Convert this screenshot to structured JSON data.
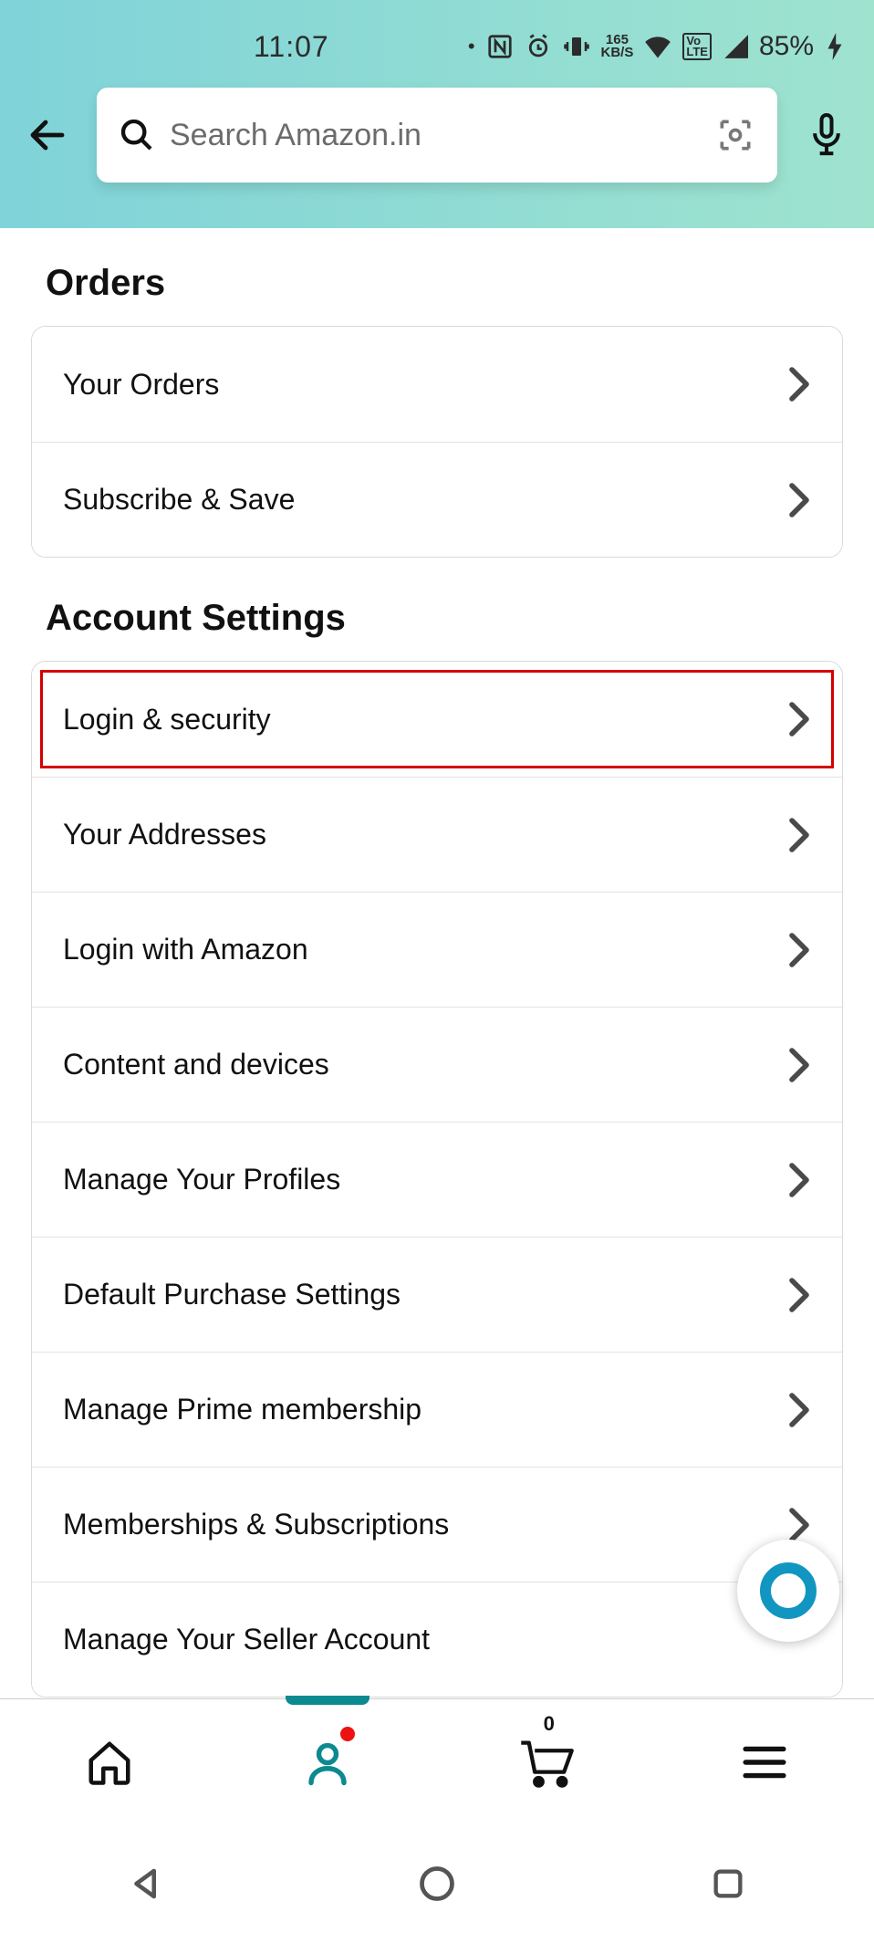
{
  "status": {
    "time": "11:07",
    "speed_value": "165",
    "speed_unit": "KB/S",
    "battery": "85%"
  },
  "search": {
    "placeholder": "Search Amazon.in"
  },
  "sections": {
    "orders": {
      "title": "Orders",
      "items": [
        {
          "label": "Your Orders"
        },
        {
          "label": "Subscribe & Save"
        }
      ]
    },
    "account": {
      "title": "Account Settings",
      "items": [
        {
          "label": "Login & security",
          "highlighted": true
        },
        {
          "label": "Your Addresses"
        },
        {
          "label": "Login with Amazon"
        },
        {
          "label": "Content and devices"
        },
        {
          "label": "Manage Your Profiles"
        },
        {
          "label": "Default Purchase Settings"
        },
        {
          "label": "Manage Prime membership"
        },
        {
          "label": "Memberships & Subscriptions"
        },
        {
          "label": "Manage Your Seller Account"
        }
      ]
    }
  },
  "bottom_nav": {
    "cart_count": "0"
  }
}
